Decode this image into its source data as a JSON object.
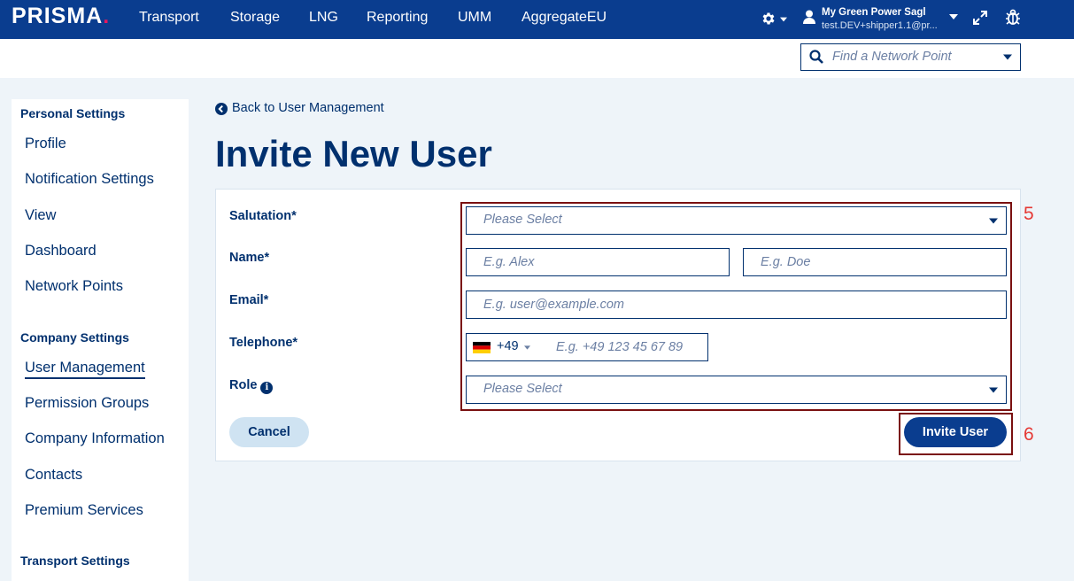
{
  "topnav": {
    "logo": "PRISMA",
    "logo_dot": ".",
    "items": [
      "Transport",
      "Storage",
      "LNG",
      "Reporting",
      "UMM",
      "AggregateEU"
    ],
    "user_name": "My Green Power Sagl",
    "user_email": "test.DEV+shipper1.1@pr...",
    "icons": [
      "gear-icon",
      "user-icon",
      "expand-icon",
      "bug-icon"
    ],
    "accent_color": "#0a3d8f",
    "logo_dot_color": "#e5185e"
  },
  "network_search": {
    "placeholder": "Find a Network Point"
  },
  "sidebar": {
    "personal_heading": "Personal Settings",
    "personal_items": [
      "Profile",
      "Notification Settings",
      "View",
      "Dashboard",
      "Network Points"
    ],
    "company_heading": "Company Settings",
    "company_items": [
      "User Management",
      "Permission Groups",
      "Company Information",
      "Contacts",
      "Premium Services"
    ],
    "transport_heading": "Transport Settings",
    "active_item": "User Management"
  },
  "main": {
    "back_link": "Back to User Management",
    "title": "Invite New User"
  },
  "form": {
    "salutation_label": "Salutation*",
    "salutation_placeholder": "Please Select",
    "name_label": "Name*",
    "first_name_placeholder": "E.g. Alex",
    "last_name_placeholder": "E.g. Doe",
    "email_label": "Email*",
    "email_placeholder": "E.g. user@example.com",
    "telephone_label": "Telephone*",
    "country_code": "+49",
    "telephone_placeholder": "E.g. +49 123 45 67 89",
    "role_label": "Role",
    "role_placeholder": "Please Select",
    "cancel_label": "Cancel",
    "invite_label": "Invite User"
  },
  "annotations": {
    "form_fields_number": "5",
    "invite_button_number": "6",
    "box_color": "#7a1010",
    "number_color": "#e53935"
  }
}
